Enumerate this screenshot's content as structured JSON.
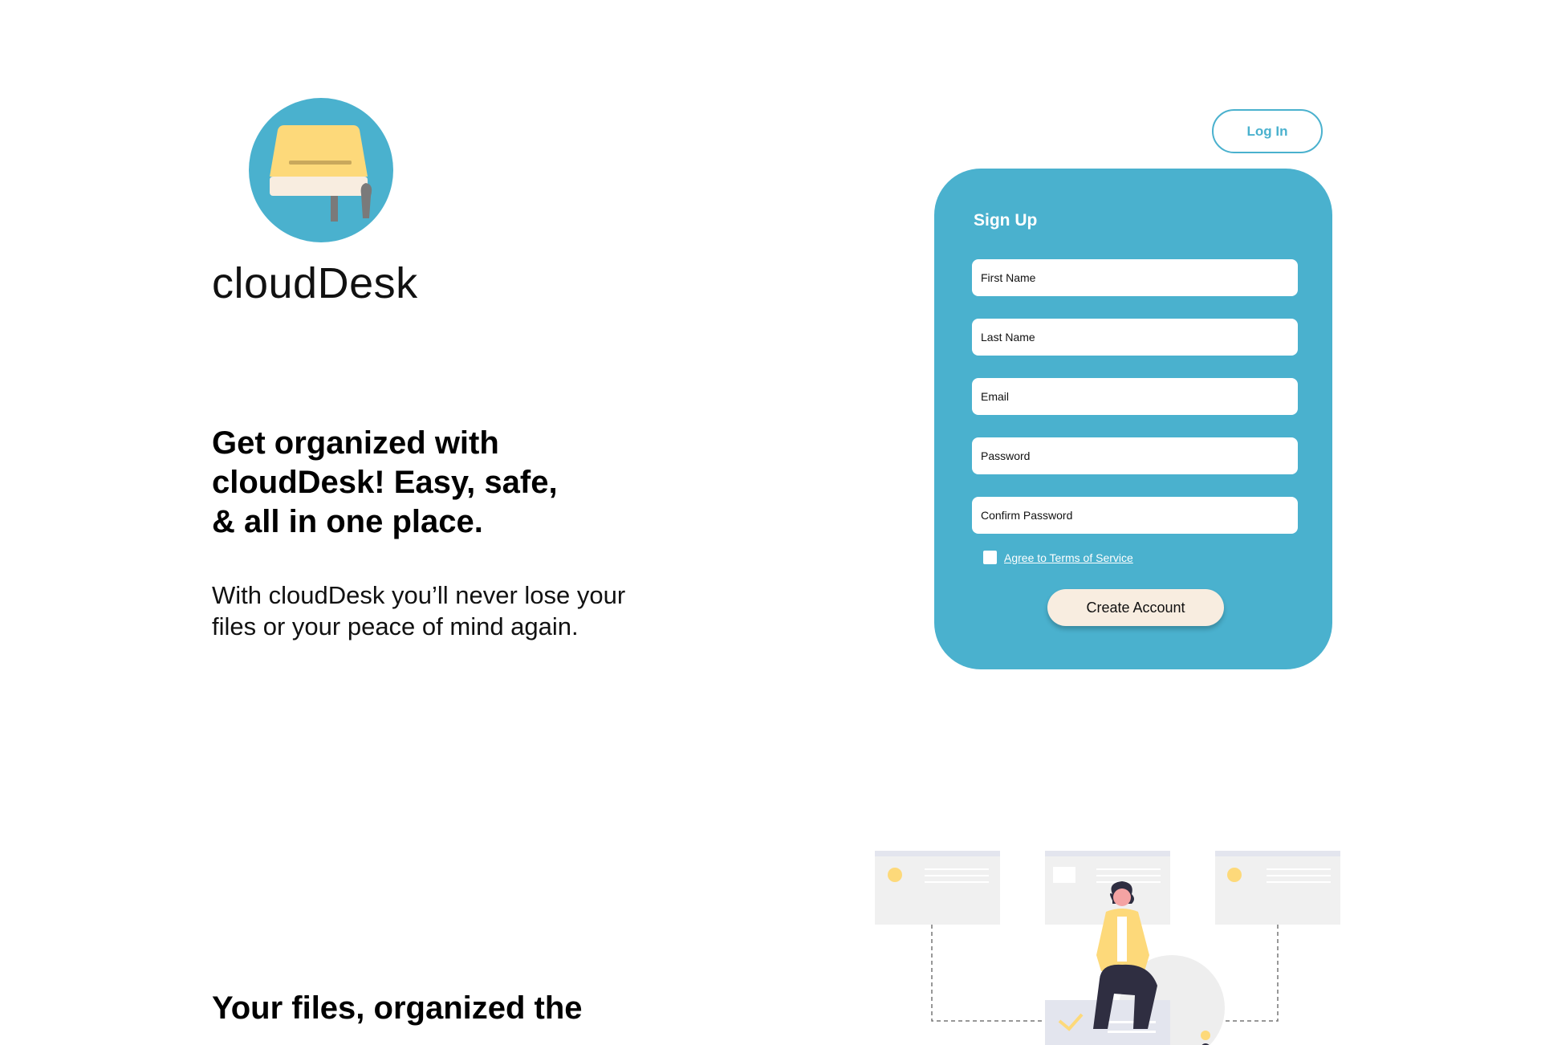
{
  "brand": {
    "name": "cloudDesk",
    "logo_icon": "desk-lamp-logo-icon",
    "colors": {
      "accent": "#4ab1ce",
      "logo_yellow": "#fdd97a",
      "cream": "#f8ede0"
    }
  },
  "header": {
    "login_label": "Log In"
  },
  "hero": {
    "heading_line1": "Get organized with",
    "heading_line2": "cloudDesk! Easy, safe,",
    "heading_line3": "& all in one place.",
    "sub_line1": "With cloudDesk you’ll never lose your",
    "sub_line2": "files or your peace of mind again."
  },
  "signup": {
    "title": "Sign Up",
    "fields": {
      "first_name": {
        "placeholder": "First Name",
        "value": ""
      },
      "last_name": {
        "placeholder": "Last Name",
        "value": ""
      },
      "email": {
        "placeholder": "Email",
        "value": ""
      },
      "password": {
        "placeholder": "Password",
        "value": ""
      },
      "confirm_password": {
        "placeholder": "Confirm Password",
        "value": ""
      }
    },
    "terms_label": "Agree to Terms of Service",
    "terms_checked": false,
    "submit_label": "Create Account"
  },
  "features": {
    "heading_line1": "Your files, organized the",
    "illustration_icon": "woman-organizing-files-illustration"
  }
}
